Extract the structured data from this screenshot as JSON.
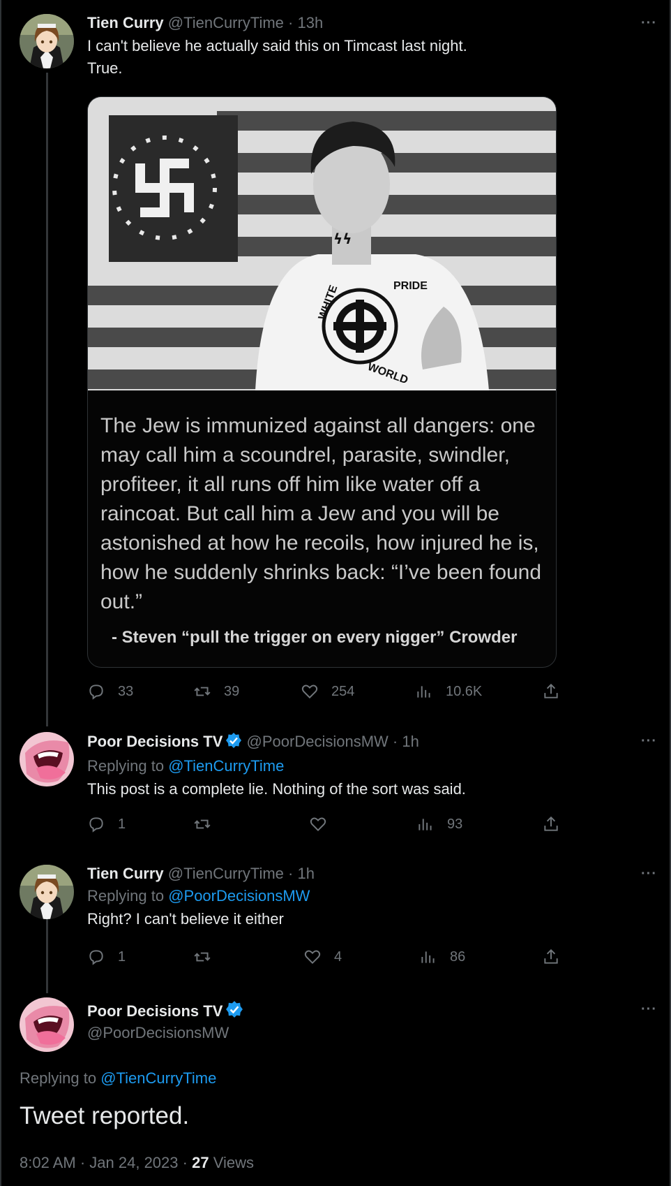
{
  "tweets": [
    {
      "name": "Tien Curry",
      "handle": "@TienCurryTime",
      "time": "13h",
      "text_lines": [
        "I can't believe he actually said this on Timcast last night.",
        "True."
      ],
      "image": {
        "quote": "The Jew is immunized against all dangers: one may call him a scoundrel, parasite, swindler, profiteer, it all runs off him like water off a raincoat. But call him a Jew and you will be astonished at how he recoils, how injured he is, how he suddenly shrinks back: “I’ve been found out.”",
        "attribution": "- Steven “pull the trigger on every nigger” Crowder",
        "shirt_text_top": "PRIDE",
        "shirt_text_left": "WHITE",
        "shirt_text_bottom": "WORLD",
        "neck_text": "ϟϟ"
      },
      "replies": "33",
      "retweets": "39",
      "likes": "254",
      "views": "10.6K"
    },
    {
      "name": "Poor Decisions TV",
      "handle": "@PoorDecisionsMW",
      "time": "1h",
      "replying_label": "Replying to ",
      "replying_to": "@TienCurryTime",
      "text": "This post is a complete lie. Nothing of the sort was said.",
      "replies": "1",
      "retweets": "",
      "likes": "",
      "views": "93"
    },
    {
      "name": "Tien Curry",
      "handle": "@TienCurryTime",
      "time": "1h",
      "replying_label": "Replying to ",
      "replying_to": "@PoorDecisionsMW",
      "text": "Right? I can't believe it either",
      "replies": "1",
      "retweets": "",
      "likes": "4",
      "views": "86"
    }
  ],
  "main_tweet": {
    "name": "Poor Decisions TV",
    "handle": "@PoorDecisionsMW",
    "replying_label": "Replying to ",
    "replying_to": "@TienCurryTime",
    "text": "Tweet reported.",
    "time": "8:02 AM",
    "date": "Jan 24, 2023",
    "views_count": "27",
    "views_label": "Views"
  },
  "separator": "·",
  "more_label": "···",
  "colors": {
    "background": "#000000",
    "text": "#e7e9ea",
    "muted": "#71767b",
    "link": "#1d9bf0",
    "verified": "#1d9bf0"
  },
  "icons": [
    "reply-icon",
    "retweet-icon",
    "like-icon",
    "views-icon",
    "share-icon",
    "more-icon",
    "verified-badge-icon"
  ]
}
